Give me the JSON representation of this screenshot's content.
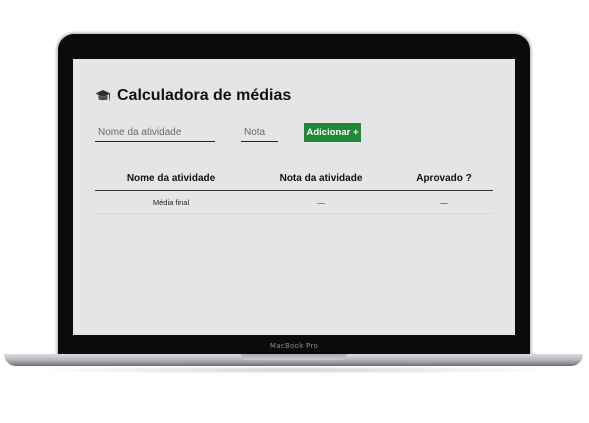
{
  "app": {
    "title": "Calculadora de médias",
    "title_icon": "graduation-cap-icon"
  },
  "form": {
    "activity_name_placeholder": "Nome da atividade",
    "activity_name_value": "",
    "grade_placeholder": "Nota",
    "grade_value": "",
    "add_button_label": "Adicionar +"
  },
  "table": {
    "headers": [
      "Nome da atividade",
      "Nota da atividade",
      "Aprovado ?"
    ],
    "footer_row": [
      "Média final",
      "—",
      "—"
    ]
  },
  "device": {
    "brand_label": "MacBook Pro"
  },
  "colors": {
    "accent": "#1e8a37",
    "screen_bg": "#e5e5e5"
  }
}
